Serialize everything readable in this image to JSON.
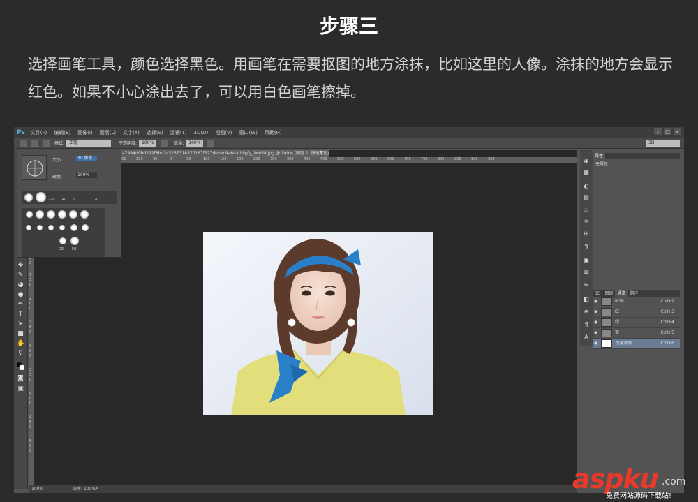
{
  "tutorial": {
    "step_title": "步骤三",
    "description": "选择画笔工具，颜色选择黑色。用画笔在需要抠图的地方涂抹，比如这里的人像。涂抹的地方会显示红色。如果不小心涂出去了，可以用白色画笔擦掉。"
  },
  "app": {
    "logo": "Ps",
    "menu": [
      "文件(F)",
      "编辑(E)",
      "图像(I)",
      "图层(L)",
      "文字(Y)",
      "选择(S)",
      "滤镜(T)",
      "3D(D)",
      "视图(V)",
      "窗口(W)",
      "帮助(H)"
    ],
    "window_controls": [
      "–",
      "□",
      "×"
    ]
  },
  "options_bar": {
    "mode_label": "模式:",
    "mode_value": "正常",
    "opacity_label": "不透明度:",
    "opacity_value": "100%",
    "flow_label": "流量:",
    "flow_value": "100%",
    "workspace": "3D"
  },
  "brush_panel": {
    "size_label": "大小:",
    "size_value": "40 像素",
    "hardness_label": "硬度:",
    "hardness_value": "100%",
    "preset_sizes": [
      "220",
      "40",
      "9",
      "20",
      "25",
      "50"
    ]
  },
  "document": {
    "tab_title": "a7994d9bd292f8bd2c3237318370167f327debec9a6c-db8gfy_fw658.jpg @ 100% (图层 1, 快速蒙版/8) *",
    "ruler_top": [
      "100",
      "150",
      "50",
      "0",
      "50",
      "100",
      "150",
      "200",
      "250",
      "300",
      "350",
      "400",
      "450",
      "500",
      "550",
      "600",
      "650",
      "700",
      "750",
      "800",
      "850",
      "900",
      "950"
    ],
    "ruler_left": [
      "2",
      "0",
      "1",
      "5",
      "0",
      "2",
      "0",
      "0",
      "2",
      "5",
      "0",
      "3",
      "0",
      "0",
      "3",
      "5",
      "0",
      "4",
      "0",
      "0",
      "4",
      "5",
      "0",
      "5",
      "0",
      "0"
    ],
    "zoom": "100%",
    "efficiency": "效率: 100%*"
  },
  "panels": {
    "properties_tab": "属性",
    "properties_body": "无属性",
    "bottom_tabs": [
      "3D",
      "图层",
      "通道",
      "路径"
    ],
    "active_tab": "通道",
    "channels": [
      {
        "name": "RGB",
        "shortcut": "Ctrl+2",
        "selected": false
      },
      {
        "name": "红",
        "shortcut": "Ctrl+3",
        "selected": false
      },
      {
        "name": "绿",
        "shortcut": "Ctrl+4",
        "selected": false
      },
      {
        "name": "蓝",
        "shortcut": "Ctrl+5",
        "selected": false
      },
      {
        "name": "快速蒙版",
        "shortcut": "Ctrl+6",
        "selected": true
      }
    ]
  },
  "watermark": {
    "logo": "aspku",
    "tld": ".com",
    "tagline": "免费网站源码下载站!"
  },
  "colors": {
    "ps_blue": "#5aa8e0",
    "selected_row": "#6a7b94",
    "watermark_red": "#e8392a"
  }
}
